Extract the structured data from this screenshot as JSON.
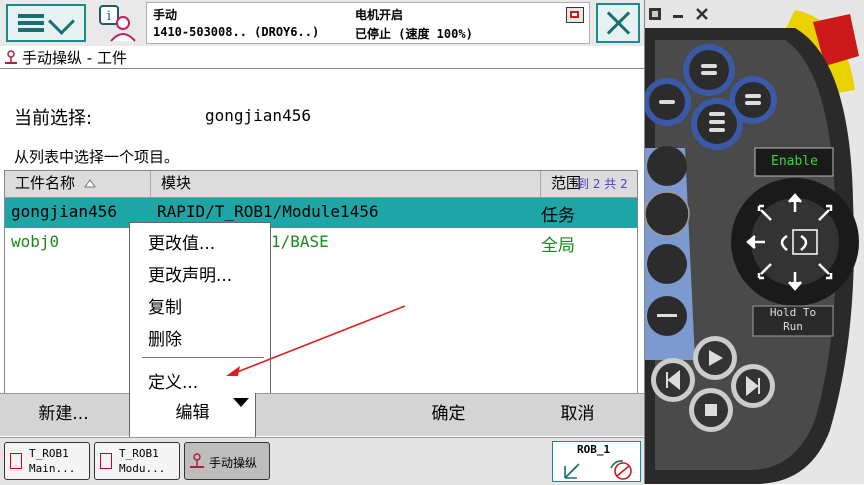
{
  "topbar": {
    "mode": "手动",
    "system_name": "1410-503008.. (DROY6..)",
    "motor_state": "电机开启",
    "run_state": "已停止 (速度 100%)"
  },
  "title": "手动操纵 - 工件",
  "current_selection": {
    "label": "当前选择:",
    "value": "gongjian456"
  },
  "instruction": "从列表中选择一个项目。",
  "table": {
    "headers": [
      "工件名称",
      "模块",
      "范围"
    ],
    "paging": "到 2 共 2",
    "rows": [
      {
        "name": "gongjian456",
        "module": "RAPID/T_ROB1/Module1456",
        "scope": "任务"
      },
      {
        "name": "wobj0",
        "module": "1/BASE",
        "scope": "全局"
      }
    ]
  },
  "context_menu": {
    "items": [
      "更改值...",
      "更改声明...",
      "复制",
      "删除",
      "定义..."
    ]
  },
  "bottom": {
    "new": "新建...",
    "edit": "编辑",
    "ok": "确定",
    "cancel": "取消"
  },
  "taskbar": {
    "tasks": [
      {
        "line1": "T_ROB1",
        "line2": "Main..."
      },
      {
        "line1": "T_ROB1",
        "line2": "Modu..."
      },
      {
        "line1": "手动操纵",
        "line2": ""
      }
    ],
    "robot": "ROB_1"
  },
  "pendant": {
    "enable_label": "Enable",
    "hold_line1": "Hold To",
    "hold_line2": "Run"
  },
  "colors": {
    "selected_row": "#1ea5a5",
    "teal_border": "#1a8a8a",
    "green_text": "#1a8a1a",
    "arrow_red": "#e02020",
    "joystick_bg": "#1a1a1a"
  }
}
